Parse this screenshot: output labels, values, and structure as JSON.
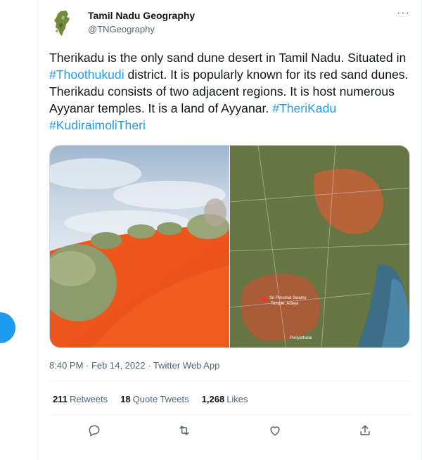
{
  "tweet": {
    "author_name": "Tamil Nadu Geography",
    "author_handle": "@TNGeography",
    "more_label": "···",
    "text_parts": {
      "p1": "Therikadu is the only sand dune desert in Tamil Nadu. Situated in ",
      "tag1": "#Thoothukudi",
      "p2": " district. It is popularly known for its red sand dunes. Therikadu consists of two adjacent regions. It is host numerous Ayyanar temples. It is a land of Ayyanar. ",
      "tag2": "#TheriKadu",
      "p3": " ",
      "tag3": "#KudiraimoliTheri"
    },
    "timestamp": "8:40 PM · Feb 14, 2022 · Twitter Web App",
    "stats": {
      "retweets_count": "211",
      "retweets_label": "Retweets",
      "quotes_count": "18",
      "quotes_label": "Quote Tweets",
      "likes_count": "1,268",
      "likes_label": "Likes"
    }
  },
  "map_labels": {
    "l1": "Sri Perumal Swamy",
    "l2": "Temple, Adaya",
    "l3": "Periyathalai"
  },
  "icons": [
    "reply-icon",
    "retweet-icon",
    "like-icon",
    "share-icon",
    "more-icon"
  ],
  "colors": {
    "accent": "#1d9bf0",
    "text": "#0f1419",
    "secondary": "#536471",
    "sand": "#e8501a"
  }
}
